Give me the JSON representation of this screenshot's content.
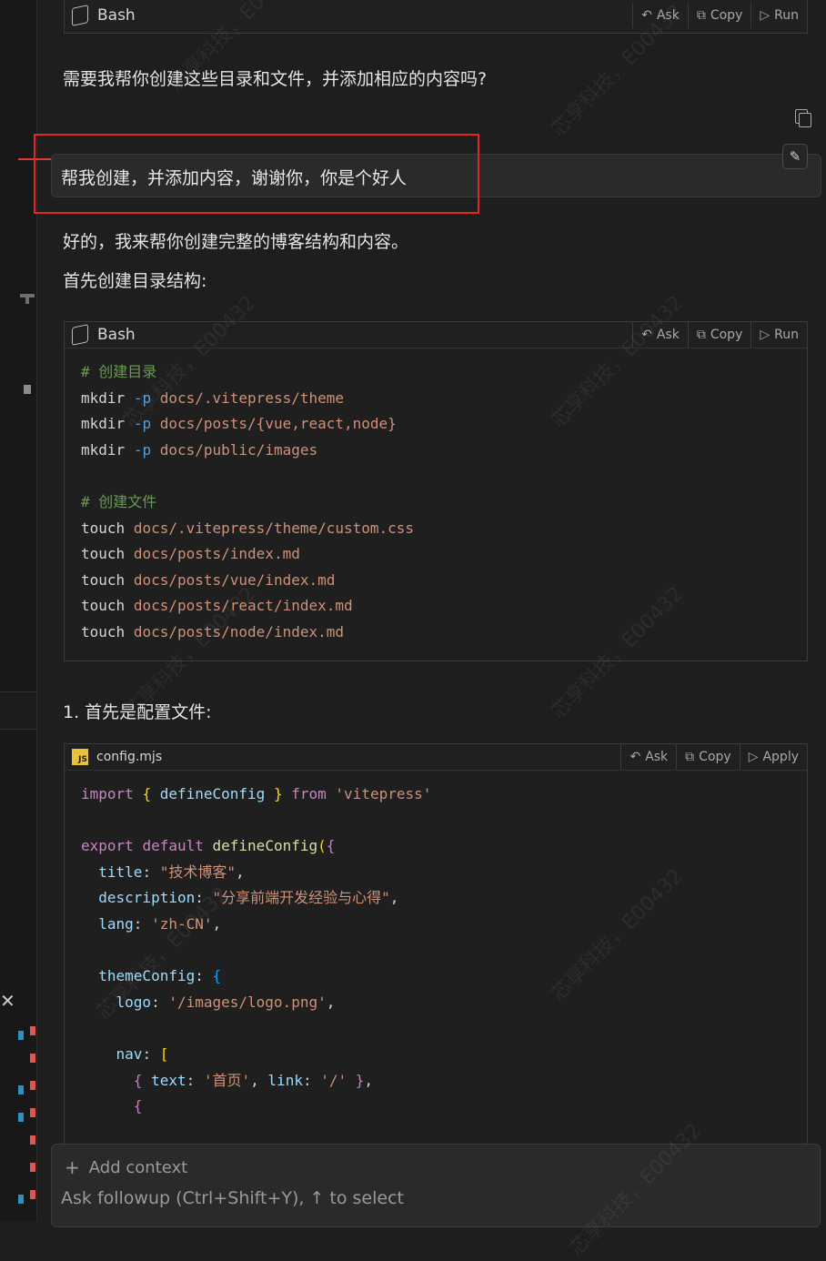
{
  "code_header_buttons": {
    "ask": "Ask",
    "copy": "Copy",
    "run": "Run",
    "apply": "Apply"
  },
  "top_block": {
    "lang": "Bash"
  },
  "assistant_question": "需要我帮你创建这些目录和文件，并添加相应的内容吗?",
  "user_message": "帮我创建，并添加内容，谢谢你，你是个好人",
  "reply_line1": "好的，我来帮你创建完整的博客结构和内容。",
  "reply_line2": "首先创建目录结构:",
  "bash_block": {
    "lang": "Bash",
    "comment1": "# 创建目录",
    "mkdir_lines": [
      {
        "cmd": "mkdir",
        "flag": "-p",
        "path": "docs/.vitepress/theme"
      },
      {
        "cmd": "mkdir",
        "flag": "-p",
        "path": "docs/posts/{vue,react,node}"
      },
      {
        "cmd": "mkdir",
        "flag": "-p",
        "path": "docs/public/images"
      }
    ],
    "comment2": "# 创建文件",
    "touch_lines": [
      {
        "cmd": "touch",
        "path": "docs/.vitepress/theme/custom.css"
      },
      {
        "cmd": "touch",
        "path": "docs/posts/index.md"
      },
      {
        "cmd": "touch",
        "path": "docs/posts/vue/index.md"
      },
      {
        "cmd": "touch",
        "path": "docs/posts/react/index.md"
      },
      {
        "cmd": "touch",
        "path": "docs/posts/node/index.md"
      }
    ]
  },
  "step1": "1. 首先是配置文件:",
  "config_block": {
    "filename": "config.mjs",
    "icon_text": "JS",
    "import_kw": "import",
    "import_name": "defineConfig",
    "from_kw": "from",
    "module": "'vitepress'",
    "export_kw": "export",
    "default_kw": "default",
    "fn_name": "defineConfig",
    "title_key": "title",
    "title_val": "\"技术博客\"",
    "desc_key": "description",
    "desc_val": "\"分享前端开发经验与心得\"",
    "lang_key": "lang",
    "lang_val": "'zh-CN'",
    "theme_key": "themeConfig",
    "logo_key": "logo",
    "logo_val": "'/images/logo.png'",
    "nav_key": "nav",
    "text_key": "text",
    "text_val": "'首页'",
    "link_key": "link",
    "link_val": "'/'"
  },
  "input": {
    "add_context": "Add context",
    "placeholder": "Ask followup (Ctrl+Shift+Y), ↑ to select"
  },
  "watermarks": [
    "芯享科技，E00432"
  ]
}
